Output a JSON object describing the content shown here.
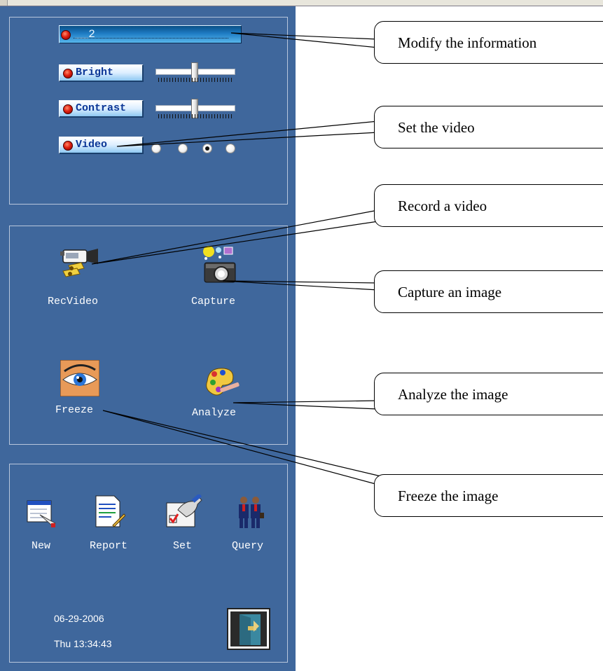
{
  "settings": {
    "info_value": "__2",
    "bright_label": "Bright",
    "bright_level": 0.5,
    "contrast_label": "Contrast",
    "contrast_level": 0.5,
    "video_label": "Video",
    "video_options_count": 4,
    "video_selected_index": 2
  },
  "actions": {
    "recvideo_label": "RecVideo",
    "capture_label": "Capture",
    "freeze_label": "Freeze",
    "analyze_label": "Analyze"
  },
  "toolbar": {
    "new_label": "New",
    "report_label": "Report",
    "set_label": "Set",
    "query_label": "Query"
  },
  "status": {
    "date": "06-29-2006",
    "time": "Thu 13:34:43"
  },
  "callouts": {
    "modify": "Modify the information",
    "set_video": "Set the video",
    "record": "Record a video",
    "capture": "Capture an image",
    "analyze": "Analyze the image",
    "freeze": "Freeze the image"
  },
  "colors": {
    "panel_bg": "#3f679c",
    "label_text": "#0b3696",
    "indicator": "#e02010"
  }
}
